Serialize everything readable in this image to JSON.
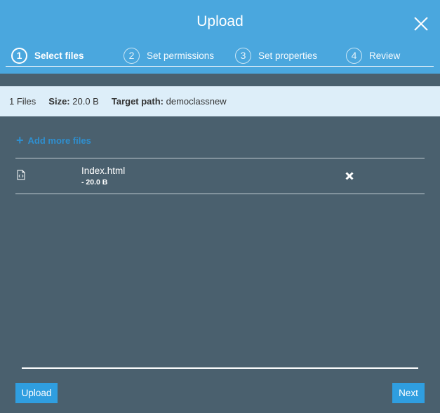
{
  "dialog": {
    "title": "Upload"
  },
  "steps": [
    {
      "number": "1",
      "label": "Select files",
      "active": true
    },
    {
      "number": "2",
      "label": "Set permissions",
      "active": false
    },
    {
      "number": "3",
      "label": "Set properties",
      "active": false
    },
    {
      "number": "4",
      "label": "Review",
      "active": false
    }
  ],
  "info": {
    "files_count": "1 Files",
    "size_label": "Size:",
    "size_value": "20.0 B",
    "target_label": "Target path:",
    "target_value": "democlassnew"
  },
  "add_more": {
    "label": "Add more files"
  },
  "files": [
    {
      "name": "Index.html",
      "size": "- 20.0 B",
      "icon": "html-file-icon"
    }
  ],
  "footer": {
    "upload_label": "Upload",
    "next_label": "Next"
  },
  "colors": {
    "header": "#4aa7de",
    "body": "#4a606e",
    "infobar": "#ddeef9",
    "accent": "#2f9ee0",
    "link": "#2f8fcf"
  }
}
